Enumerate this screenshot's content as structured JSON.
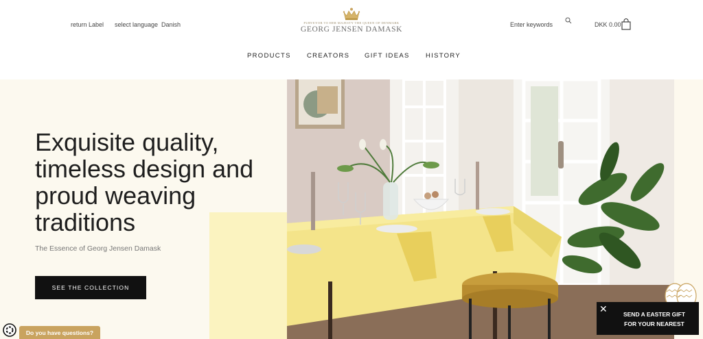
{
  "header": {
    "return_label": "return Label",
    "select_language": "select language",
    "language_value": "Danish",
    "logo_tagline": "PURVEYOR TO HER MAJESTY THE QUEEN OF DENMARK",
    "logo_name": "GEORG JENSEN DAMASK",
    "search_placeholder": "Enter keywords",
    "cart_total": "DKK 0.00"
  },
  "nav": {
    "items": [
      "PRODUCTS",
      "CREATORS",
      "GIFT IDEAS",
      "HISTORY"
    ]
  },
  "hero": {
    "title": "Exquisite quality, timeless design and proud weaving traditions",
    "subtitle": "The Essence of Georg Jensen Damask",
    "cta_label": "SEE THE COLLECTION"
  },
  "chat": {
    "label": "Do you have questions?"
  },
  "promo": {
    "line1": "SEND A EASTER GIFT",
    "line2": "FOR YOUR NEAREST",
    "close": "✕"
  },
  "colors": {
    "accent_gold": "#c9a35f",
    "hero_bg": "#fcf9ef",
    "cta_bg": "#111111"
  }
}
